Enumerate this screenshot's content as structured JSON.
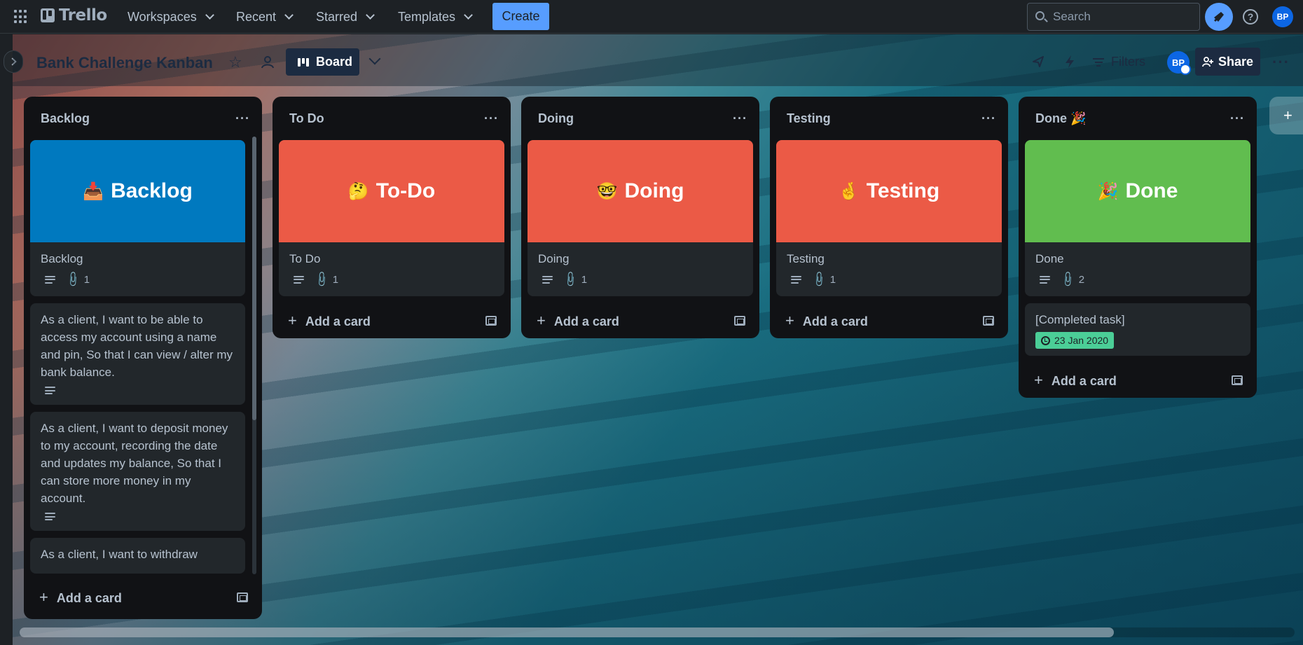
{
  "topnav": {
    "logo": "Trello",
    "menus": [
      "Workspaces",
      "Recent",
      "Starred",
      "Templates"
    ],
    "create_label": "Create",
    "search_placeholder": "Search",
    "avatar": "BP"
  },
  "board": {
    "title": "Bank Challenge Kanban",
    "view_label": "Board",
    "filters_label": "Filters",
    "share_label": "Share",
    "avatar": "BP",
    "add_list_label": "+"
  },
  "lists": [
    {
      "title": "Backlog",
      "cover_card": {
        "cover_text": "Backlog",
        "cover_emoji": "📥",
        "cover_color": "#0079bf",
        "title": "Backlog",
        "attachments": "1"
      },
      "cards": [
        "As a client, I want to be able to access my account using a name and pin, So that I can view / alter my bank balance.",
        "As a client, I want to deposit money to my account, recording the date and updates my balance, So that I can store more money in my account.",
        "As a client, I want to withdraw"
      ],
      "add_card": "Add a card"
    },
    {
      "title": "To Do",
      "cover_card": {
        "cover_text": "To-Do",
        "cover_emoji": "🤔",
        "cover_color": "#eb5a46",
        "title": "To Do",
        "attachments": "1"
      },
      "add_card": "Add a card"
    },
    {
      "title": "Doing",
      "cover_card": {
        "cover_text": "Doing",
        "cover_emoji": "🤓",
        "cover_color": "#eb5a46",
        "title": "Doing",
        "attachments": "1"
      },
      "add_card": "Add a card"
    },
    {
      "title": "Testing",
      "cover_card": {
        "cover_text": "Testing",
        "cover_emoji": "🤞",
        "cover_color": "#eb5a46",
        "title": "Testing",
        "attachments": "1"
      },
      "add_card": "Add a card"
    },
    {
      "title": "Done 🎉",
      "cover_card": {
        "cover_text": "Done",
        "cover_emoji": "🎉",
        "cover_color": "#61bd4f",
        "title": "Done",
        "attachments": "2"
      },
      "cards": [
        "[Completed task]"
      ],
      "date_badge": "23 Jan 2020",
      "add_card": "Add a card"
    }
  ]
}
